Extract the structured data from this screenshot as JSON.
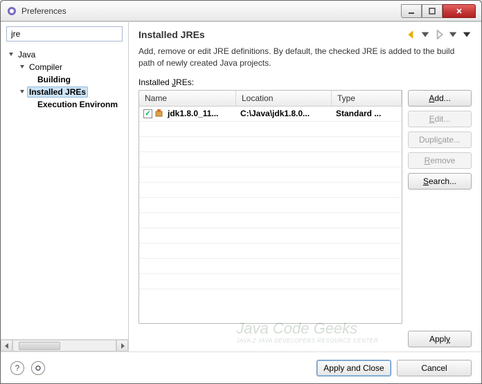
{
  "window": {
    "title": "Preferences"
  },
  "filter": {
    "value": "jre"
  },
  "tree": {
    "java": "Java",
    "compiler": "Compiler",
    "building": "Building",
    "installed_jres": "Installed JREs",
    "exec_env": "Execution Environm"
  },
  "page": {
    "title": "Installed JREs",
    "desc": "Add, remove or edit JRE definitions. By default, the checked JRE is added to the build path of newly created Java projects.",
    "subhead_prefix": "Installed ",
    "subhead_u": "J",
    "subhead_suffix": "REs:"
  },
  "table": {
    "cols": {
      "name": "Name",
      "location": "Location",
      "type": "Type"
    },
    "rows": [
      {
        "checked": true,
        "name": "jdk1.8.0_11...",
        "location": "C:\\Java\\jdk1.8.0...",
        "type": "Standard ..."
      }
    ]
  },
  "buttons": {
    "add_u": "A",
    "add_rest": "dd...",
    "edit_u": "E",
    "edit_rest": "dit...",
    "dup": "Dupli",
    "dup_u": "c",
    "dup_rest": "ate...",
    "remove_u": "R",
    "remove_rest": "emove",
    "search_u": "S",
    "search_rest": "earch...",
    "apply": "Appl",
    "apply_u": "y",
    "apply_close": "Apply and Close",
    "cancel": "Cancel"
  },
  "watermark": {
    "main": "Java Code Geeks",
    "sub": "JAVA 2 JAVA DEVELOPERS RESOURCE CENTER"
  }
}
